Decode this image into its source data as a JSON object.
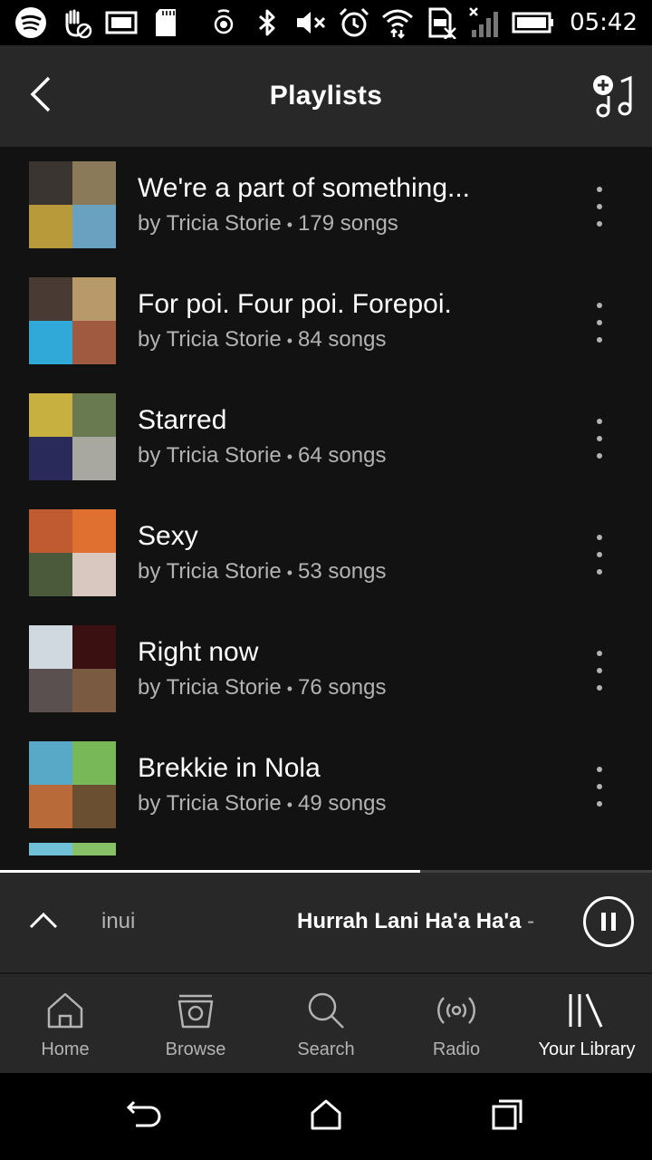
{
  "status_bar": {
    "time": "05:42",
    "icons": [
      "spotify-icon",
      "hand-blocked-icon",
      "image-icon",
      "sd-card-icon",
      "hotspot-icon",
      "bluetooth-icon",
      "mute-icon",
      "alarm-icon",
      "wifi-icon",
      "no-sim-icon",
      "signal-icon",
      "battery-icon"
    ]
  },
  "header": {
    "title": "Playlists",
    "back_icon": "chevron-left-icon",
    "add_icon": "add-playlist-icon"
  },
  "playlists": [
    {
      "title": "We're a part of something...",
      "owner": "by Tricia Storie",
      "separator": "•",
      "count": "179 songs",
      "cover_colors": [
        "#3a3530",
        "#8a7a5a",
        "#b89a3a",
        "#6aa0c0"
      ]
    },
    {
      "title": "For poi. Four poi. Forepoi.",
      "owner": "by Tricia Storie",
      "separator": "•",
      "count": "84 songs",
      "cover_colors": [
        "#4a3a34",
        "#b89a6a",
        "#30a8d8",
        "#a05a40"
      ]
    },
    {
      "title": "Starred",
      "owner": "by Tricia Storie",
      "separator": "•",
      "count": "64 songs",
      "cover_colors": [
        "#c8b040",
        "#6a7a50",
        "#2a2a5a",
        "#a8a8a0"
      ]
    },
    {
      "title": "Sexy",
      "owner": "by Tricia Storie",
      "separator": "•",
      "count": "53 songs",
      "cover_colors": [
        "#c05a30",
        "#e07030",
        "#4a5a3a",
        "#d8c8c0"
      ]
    },
    {
      "title": "Right now",
      "owner": "by Tricia Storie",
      "separator": "•",
      "count": "76 songs",
      "cover_colors": [
        "#d0d8e0",
        "#3a1010",
        "#5a5050",
        "#7a5a40"
      ]
    },
    {
      "title": "Brekkie in Nola",
      "owner": "by Tricia Storie",
      "separator": "•",
      "count": "49 songs",
      "cover_colors": [
        "#58a8c8",
        "#78b858",
        "#b86a38",
        "#6a5030"
      ]
    }
  ],
  "partial_cover_colors": [
    "#70c0d8",
    "#88c068"
  ],
  "now_playing": {
    "previous_fragment": "inui",
    "track": "Hurrah Lani Ha'a Ha'a",
    "dash": "-",
    "progress": 0.645
  },
  "tabs": [
    {
      "label": "Home",
      "icon": "home-icon",
      "active": false
    },
    {
      "label": "Browse",
      "icon": "browse-icon",
      "active": false
    },
    {
      "label": "Search",
      "icon": "search-icon",
      "active": false
    },
    {
      "label": "Radio",
      "icon": "radio-icon",
      "active": false
    },
    {
      "label": "Your Library",
      "icon": "library-icon",
      "active": true
    }
  ]
}
